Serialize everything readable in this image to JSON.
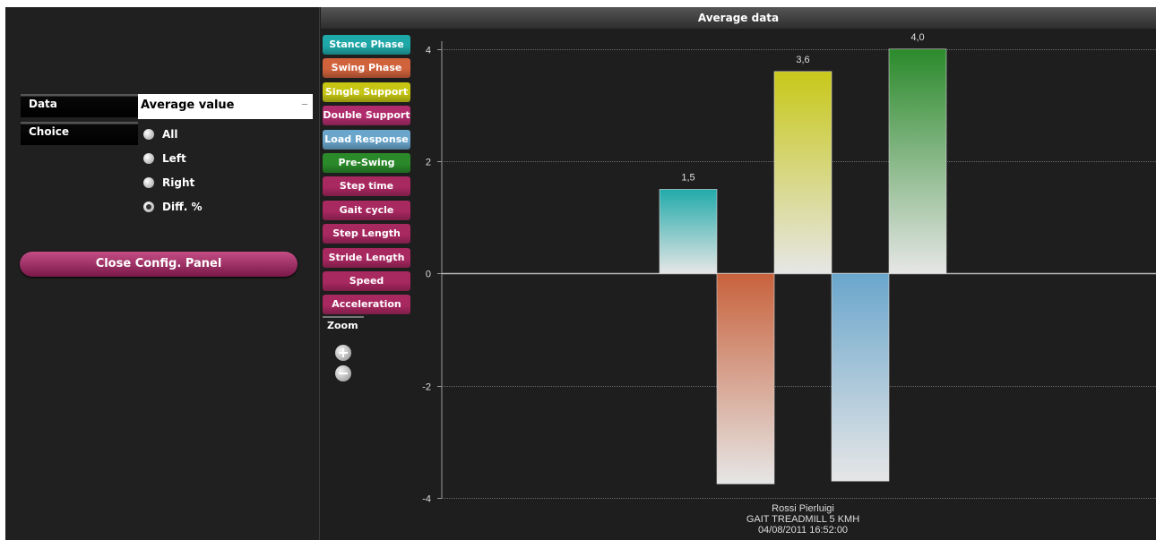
{
  "config": {
    "data_label": "Data",
    "data_value": "Average value",
    "choice_label": "Choice",
    "radio": [
      "All",
      "Left",
      "Right",
      "Diff. %"
    ],
    "selected": "Diff. %",
    "close_button": "Close Config. Panel"
  },
  "legend": [
    {
      "label": "Stance Phase",
      "color": "#1fa8a8"
    },
    {
      "label": "Swing Phase",
      "color": "#d0623c"
    },
    {
      "label": "Single Support",
      "color": "#c6c613"
    },
    {
      "label": "Double Support",
      "color": "#b02c6c"
    },
    {
      "label": "Load Response",
      "color": "#6aa6cc"
    },
    {
      "label": "Pre-Swing",
      "color": "#2a8a2a"
    },
    {
      "label": "Step time",
      "color": "#a82860"
    },
    {
      "label": "Gait cycle",
      "color": "#a82860"
    },
    {
      "label": "Step Length",
      "color": "#a82860"
    },
    {
      "label": "Stride Length",
      "color": "#a82860"
    },
    {
      "label": "Speed",
      "color": "#a82860"
    },
    {
      "label": "Acceleration",
      "color": "#a82860"
    }
  ],
  "zoom": {
    "label": "Zoom"
  },
  "chart_data": {
    "type": "bar",
    "title": "Average data",
    "categories": [
      "Rossi Pierluigi\nGAIT TREADMILL 5 KMH\n04/08/2011 16:52:00"
    ],
    "category_lines": [
      "Rossi Pierluigi",
      "GAIT TREADMILL 5 KMH",
      "04/08/2011 16:52:00"
    ],
    "series": [
      {
        "name": "Stance Phase",
        "values": [
          1.5
        ],
        "label": "1,5",
        "color": "#22aaaa"
      },
      {
        "name": "Swing Phase",
        "values": [
          -3.75
        ],
        "label": "",
        "color": "#c8623c"
      },
      {
        "name": "Single Support",
        "values": [
          3.6
        ],
        "label": "3,6",
        "color": "#c8c81a"
      },
      {
        "name": "Load Response",
        "values": [
          -3.7
        ],
        "label": "",
        "color": "#6aa6cc"
      },
      {
        "name": "Pre-Swing",
        "values": [
          4.0
        ],
        "label": "4,0",
        "color": "#2b8a2b"
      }
    ],
    "ylim": [
      -4,
      4.3
    ],
    "yticks": [
      -4,
      -2,
      0,
      2,
      4
    ],
    "grid": true
  }
}
